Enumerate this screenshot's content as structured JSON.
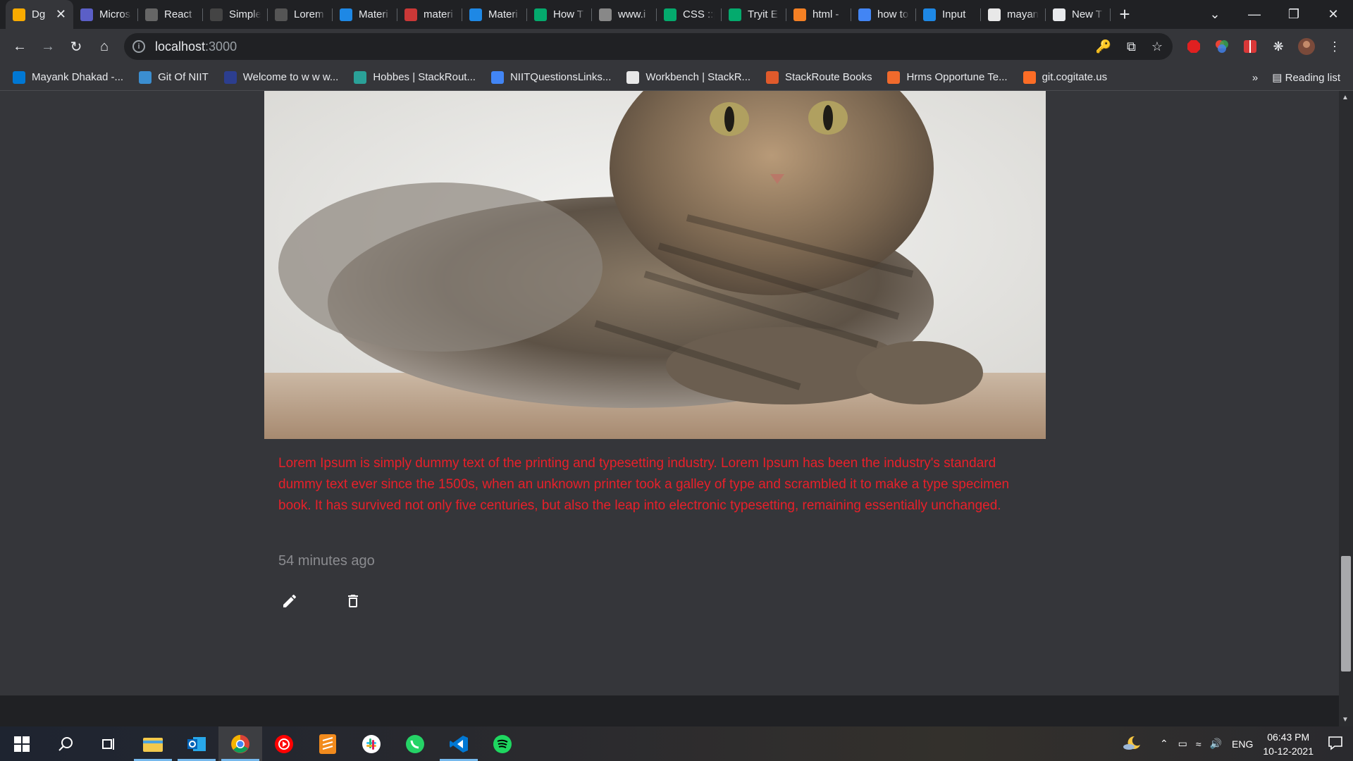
{
  "browser": {
    "tabs": [
      {
        "label": "Dg",
        "icon": "react-warning-icon",
        "color": "#f9ab00",
        "active": true
      },
      {
        "label": "Micros",
        "icon": "teams-icon",
        "color": "#5b5fc7"
      },
      {
        "label": "React",
        "icon": "react-site-icon",
        "color": "#666"
      },
      {
        "label": "Simple",
        "icon": "codesandbox-icon",
        "color": "#444"
      },
      {
        "label": "Lorem",
        "icon": "lorem-icon",
        "color": "#555"
      },
      {
        "label": "Materi",
        "icon": "mui-icon",
        "color": "#1e88e5"
      },
      {
        "label": "materi",
        "icon": "npm-icon",
        "color": "#cb3837"
      },
      {
        "label": "Materi",
        "icon": "mui-icon",
        "color": "#1e88e5"
      },
      {
        "label": "How T",
        "icon": "w3schools-icon",
        "color": "#04aa6d"
      },
      {
        "label": "www.i",
        "icon": "globe-icon",
        "color": "#888"
      },
      {
        "label": "CSS ::p",
        "icon": "w3schools-icon",
        "color": "#04aa6d"
      },
      {
        "label": "Tryit E",
        "icon": "w3schools-icon",
        "color": "#04aa6d"
      },
      {
        "label": "html -",
        "icon": "stackoverflow-icon",
        "color": "#f48024"
      },
      {
        "label": "how to",
        "icon": "google-icon",
        "color": "#4285f4"
      },
      {
        "label": "Input",
        "icon": "mui-icon",
        "color": "#1e88e5"
      },
      {
        "label": "mayan",
        "icon": "blogger-icon",
        "color": "#e8e8e8"
      },
      {
        "label": "New T",
        "icon": "chrome-icon",
        "color": "#e8eaed"
      }
    ],
    "new_tab": "+",
    "url_host": "localhost",
    "url_port": ":3000",
    "bookmarks": [
      {
        "label": "Mayank Dhakad -...",
        "icon": "outlook-icon",
        "color": "#0078d4"
      },
      {
        "label": "Git Of NIIT",
        "icon": "git-niit-icon",
        "color": "#3b8ed0"
      },
      {
        "label": "Welcome to w w w...",
        "icon": "niit-icon",
        "color": "#2c3e8f"
      },
      {
        "label": "Hobbes | StackRout...",
        "icon": "hobbes-icon",
        "color": "#2aa198"
      },
      {
        "label": "NIITQuestionsLinks...",
        "icon": "docs-icon",
        "color": "#4285f4"
      },
      {
        "label": "Workbench | StackR...",
        "icon": "workbench-icon",
        "color": "#e8e8e8"
      },
      {
        "label": "StackRoute Books",
        "icon": "books-icon",
        "color": "#e05a2b"
      },
      {
        "label": "Hrms Opportune Te...",
        "icon": "hrms-icon",
        "color": "#f06a2c"
      },
      {
        "label": "git.cogitate.us",
        "icon": "gitlab-icon",
        "color": "#fc6d26"
      }
    ],
    "more_bookmarks": "»",
    "reading_list": "Reading list"
  },
  "post": {
    "text": "Lorem Ipsum is simply dummy text of the printing and typesetting industry. Lorem Ipsum has been the industry's standard dummy text ever since the 1500s, when an unknown printer took a galley of type and scrambled it to make a type specimen book. It has survived not only five centuries, but also the leap into electronic typesetting, remaining essentially unchanged.",
    "time": "54 minutes ago",
    "text_color": "#e8202a"
  },
  "taskbar": {
    "apps": [
      "start-icon",
      "search-icon",
      "task-view-icon",
      "file-explorer-icon",
      "outlook-icon",
      "chrome-icon",
      "youtube-music-icon",
      "sublime-icon",
      "slack-icon",
      "whatsapp-icon",
      "vscode-icon",
      "spotify-icon"
    ],
    "lang": "ENG",
    "time": "06:43 PM",
    "date": "10-12-2021"
  }
}
